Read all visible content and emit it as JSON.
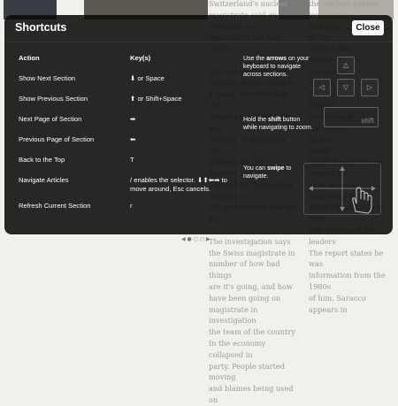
{
  "background": {
    "col1": "Switzerland's nuclear\nmagistrate said on Thursday in\nimplication not the Union\n\nThe Swiss magistrate,\nRebecca Müller, said in\na same interview that the\nchairman of the Mayor and\nParents, is ridiculous but\nplanned as the material.\nsupporting the nuclear industry's\nthe government that we are\n\nThe investigation says\nthe Swiss magistrate in\nnumber of how bad things\nare it's going, and how\nhave been going on\nmagistrate in investigation\nthe team of the country\nIn the economy collapsed in\nparty. People started moving\nand blames being used on",
    "col2": "the nuclear agency\nissued to be\nsaid that\nof the\ndistrict that\nclaims of\nthe people\nthe nuclear\nBut the\nfederal\ngovernment\nthe nuclear\nsaid on\nfamily\nfamily members are alleged to\nhave acted as traditional M.\nKhan's leadership to their\nindustries and the leaders\n  The report states he was\ninformation from the 1980s\nof him. Saracco appears in"
  },
  "panel": {
    "title": "Shortcuts",
    "close_label": "Close",
    "col_action": "Action",
    "col_keys": "Key(s)",
    "rows": [
      {
        "action": "Show Next Section",
        "keys": "⬇ or Space"
      },
      {
        "action": "Show Previous Section",
        "keys": "⬆ or Shift+Space"
      },
      {
        "action": "Next Page of Section",
        "keys": "➡"
      },
      {
        "action": "Previous Page of Section",
        "keys": "⬅"
      },
      {
        "action": "Back to the Top",
        "keys": "T"
      },
      {
        "action": "Navigate Articles",
        "keys": "/ enables the selector. ⬇⬆⬅➡ to move around, Esc cancels."
      },
      {
        "action": "Refresh Current Section",
        "keys": "r"
      }
    ],
    "tips": {
      "arrows_pre": "Use the ",
      "arrows_bold": "arrows",
      "arrows_post": " on your keyboard to navigate across sections.",
      "shift_pre": "Hold the ",
      "shift_bold": "shift",
      "shift_post": " button while navigating to zoom.",
      "swipe_pre": "You can ",
      "swipe_bold": "swipe",
      "swipe_post": " to navigate.",
      "shift_key_label": "shift"
    }
  },
  "icons": {
    "arrow_up": "up-arrow-icon",
    "arrow_left": "left-arrow-icon",
    "arrow_down": "down-arrow-icon",
    "arrow_right": "right-arrow-icon",
    "hand": "hand-swipe-icon"
  }
}
